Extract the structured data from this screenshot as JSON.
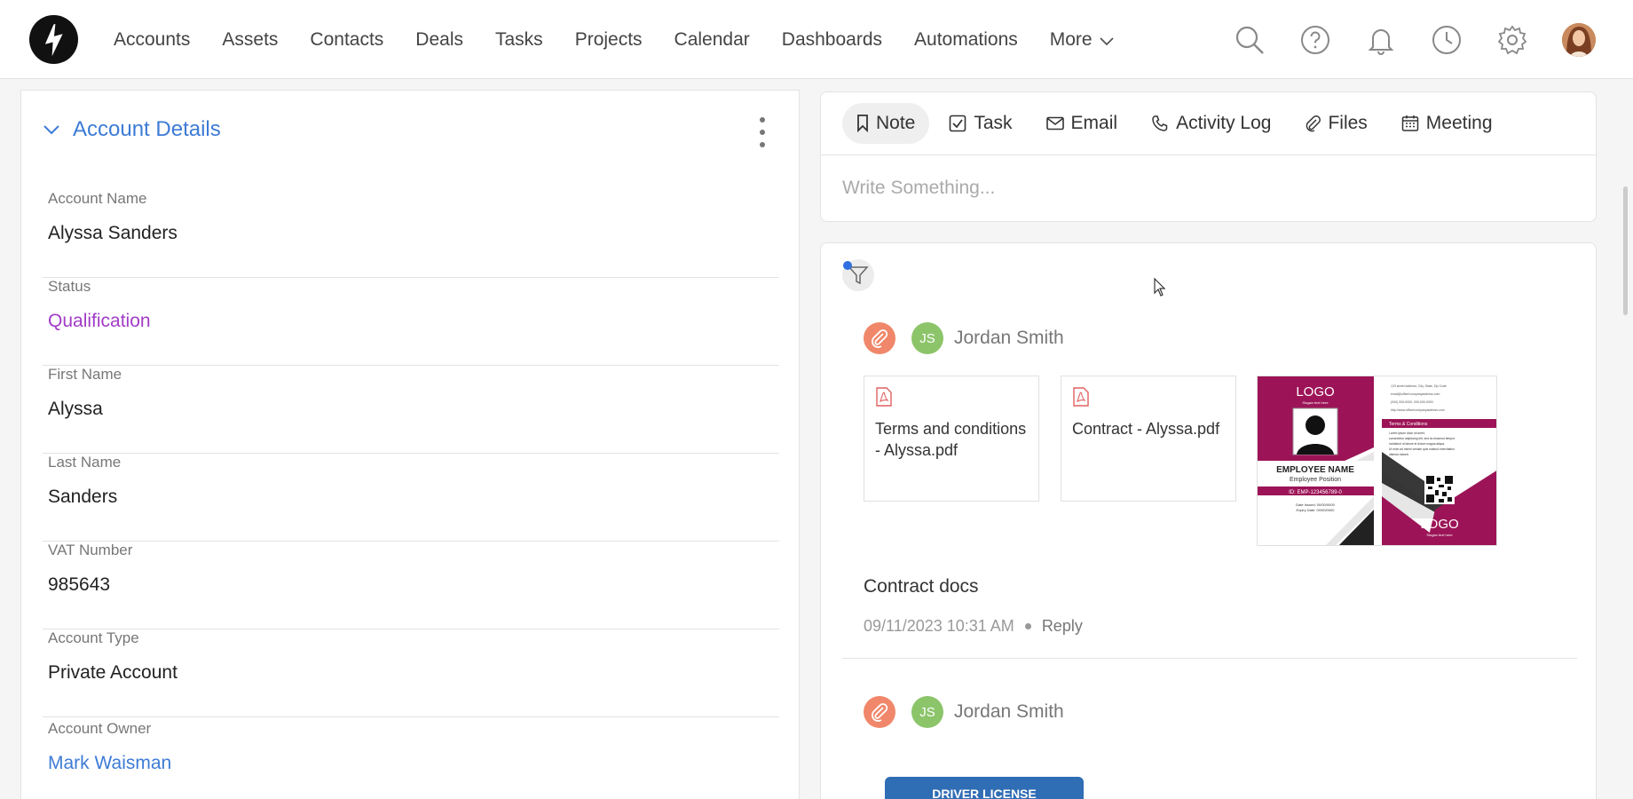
{
  "nav": {
    "items": [
      "Accounts",
      "Assets",
      "Contacts",
      "Deals",
      "Tasks",
      "Projects",
      "Calendar",
      "Dashboards",
      "Automations"
    ],
    "more_label": "More"
  },
  "top_icons": [
    "search-icon",
    "help-icon",
    "bell-icon",
    "clock-icon",
    "gear-icon"
  ],
  "account": {
    "title": "Account Details",
    "fields": [
      {
        "label": "Account Name",
        "value": "Alyssa Sanders"
      },
      {
        "label": "Status",
        "value": "Qualification"
      },
      {
        "label": "First Name",
        "value": "Alyssa"
      },
      {
        "label": "Last Name",
        "value": "Sanders"
      },
      {
        "label": "VAT Number",
        "value": "985643"
      },
      {
        "label": "Account Type",
        "value": "Private Account"
      },
      {
        "label": "Account Owner",
        "value": "Mark Waisman"
      }
    ]
  },
  "composer": {
    "tabs": [
      "Note",
      "Task",
      "Email",
      "Activity Log",
      "Files",
      "Meeting"
    ],
    "placeholder": "Write Something..."
  },
  "feed": {
    "activities": [
      {
        "initials": "JS",
        "author": "Jordan Smith",
        "files": [
          "Terms and conditions - Alyssa.pdf",
          "Contract - Alyssa.pdf"
        ],
        "id_card": {
          "front_logo": "LOGO",
          "front_tagline": "Slogan text here",
          "front_name": "EMPLOYEE NAME",
          "front_position": "Employee Position",
          "front_id": "ID: EMP-123456789-0",
          "front_issued": "Date Issued: 00/00/0000",
          "front_expiry": "Expiry Date: 00/00/0000",
          "back_contacts": [
            "123 street address, City, State, Zip Code",
            "email@office/companyaddress.com",
            "(000) 000-0000, 000-000-0000",
            "http://www.office/companyaddress.com"
          ],
          "back_terms_title": "Terms & Conditions",
          "back_terms": [
            "Lorem ipsum dolor sit amet,",
            "consectetur adipiscing elit, sed do eiusmod tempor",
            "incididunt ut labore et dolore magna aliqua.",
            "Ut enim ad minim veniam quis nostrud exercitation",
            "ullamco laboris"
          ],
          "back_logo": "LOGO",
          "back_tagline": "Slogan text here"
        },
        "note": "Contract docs",
        "timestamp": "09/11/2023 10:31 AM",
        "reply_label": "Reply"
      },
      {
        "initials": "JS",
        "author": "Jordan Smith",
        "preview_label": "DRIVER LICENSE"
      }
    ]
  },
  "colors": {
    "accent": "#3d7bd6",
    "status": "#a23cc7",
    "clip_badge": "#f0876a",
    "initials_badge": "#8cc46a",
    "id_card_magenta": "#9c1457"
  }
}
